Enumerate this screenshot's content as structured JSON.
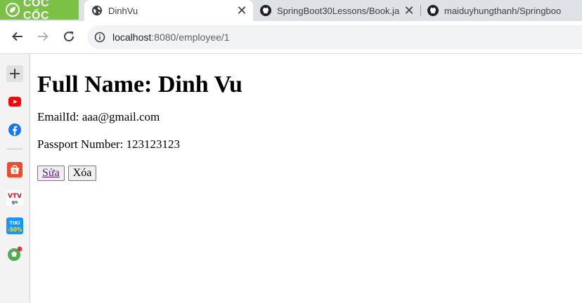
{
  "browser": {
    "brand": "CỐC CỐC",
    "tabs": [
      {
        "title": "DinhVu",
        "active": true,
        "icon": "globe-icon"
      },
      {
        "title": "SpringBoot30Lessons/Book.ja",
        "active": false,
        "icon": "github-icon"
      },
      {
        "title": "maiduyhungthanh/Springboo",
        "active": false,
        "icon": "github-icon"
      }
    ],
    "address": {
      "host": "localhost",
      "path": ":8080/employee/1"
    },
    "sidebar": [
      "add-icon",
      "youtube-icon",
      "facebook-icon",
      "shopee-icon",
      "vtv-go-icon",
      "tiki-icon",
      "football-icon"
    ],
    "colors": {
      "brand": "#7bc146",
      "tabstrip": "#dee1e6",
      "visited_link": "#551a8b"
    }
  },
  "page": {
    "heading": "Full Name: Dinh Vu",
    "email": "EmailId: aaa@gmail.com",
    "passport": "Passport Number: 123123123",
    "edit_label": "Sửa",
    "delete_label": "Xóa"
  }
}
